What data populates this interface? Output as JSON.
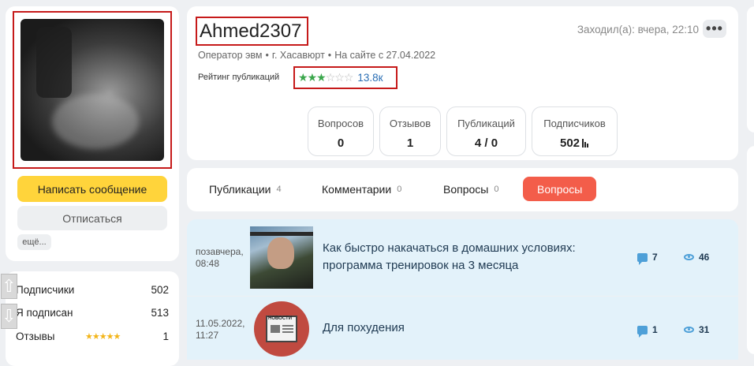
{
  "profile": {
    "username": "Ahmed2307",
    "last_seen": "Заходил(а): вчера, 22:10",
    "more_label": "•••",
    "occupation": "Оператор эвм",
    "city": "г. Хасавюрт",
    "member_since": "На сайте с 27.04.2022",
    "rating_label": "Рейтинг публикаций",
    "rating_stars_filled": 3,
    "rating_stars_total": 6,
    "rating_value": "13.8к"
  },
  "actions": {
    "message_label": "Написать сообщение",
    "unsubscribe_label": "Отписаться",
    "more_label": "ещё..."
  },
  "counters": [
    {
      "label": "Вопросов",
      "value": "0"
    },
    {
      "label": "Отзывов",
      "value": "1"
    },
    {
      "label": "Публикаций",
      "value": "4 / 0"
    },
    {
      "label": "Подписчиков",
      "value": "502"
    }
  ],
  "side_stats": [
    {
      "label": "Подписчики",
      "value": "502"
    },
    {
      "label": "Я подписан",
      "value": "513"
    },
    {
      "label": "Отзывы",
      "value": "1",
      "stars": "★★★★★"
    }
  ],
  "tabs": [
    {
      "label": "Публикации",
      "count": "4"
    },
    {
      "label": "Комментарии",
      "count": "0"
    },
    {
      "label": "Вопросы",
      "count": "0"
    },
    {
      "label": "Вопросы",
      "count": ""
    }
  ],
  "posts": [
    {
      "date_line1": "позавчера,",
      "date_line2": "08:48",
      "title_line1": "Как быстро накачаться в домашних условиях:",
      "title_line2": "программа тренировок на 3 месяца",
      "comments": "7",
      "views": "46"
    },
    {
      "date_line1": "11.05.2022,",
      "date_line2": "11:27",
      "title_line1": "Для похудения",
      "thumb_text": "НОВОСТИ",
      "comments": "1",
      "views": "31"
    }
  ],
  "colors": {
    "accent_yellow": "#ffd43b",
    "accent_red": "#f35d4a",
    "highlight_border": "#c61a1a",
    "rating_green": "#3aa64b",
    "link_blue": "#2b6fb5",
    "list_bg": "#e3f2fa"
  },
  "icons": [
    "arrow-up-icon",
    "arrow-down-icon",
    "comment-icon",
    "eye-icon",
    "bars-icon",
    "star-icon"
  ]
}
